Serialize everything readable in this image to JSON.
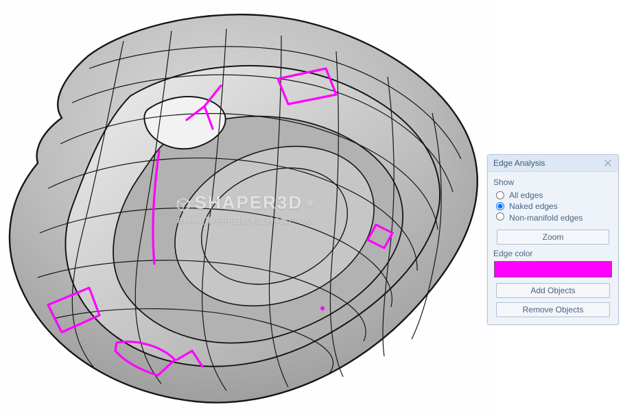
{
  "watermark": {
    "title": "SHAPER3D",
    "registered": "®",
    "subtitle": "Rhino(犀牛)中国技术支持&推广中心"
  },
  "panel": {
    "title": "Edge Analysis",
    "show_label": "Show",
    "options": {
      "all": "All edges",
      "naked": "Naked edges",
      "nonmanifold": "Non-manifold edges"
    },
    "selected": "naked",
    "zoom": "Zoom",
    "edge_color_label": "Edge color",
    "edge_color": "#ff00ff",
    "add_objects": "Add Objects",
    "remove_objects": "Remove Objects"
  }
}
